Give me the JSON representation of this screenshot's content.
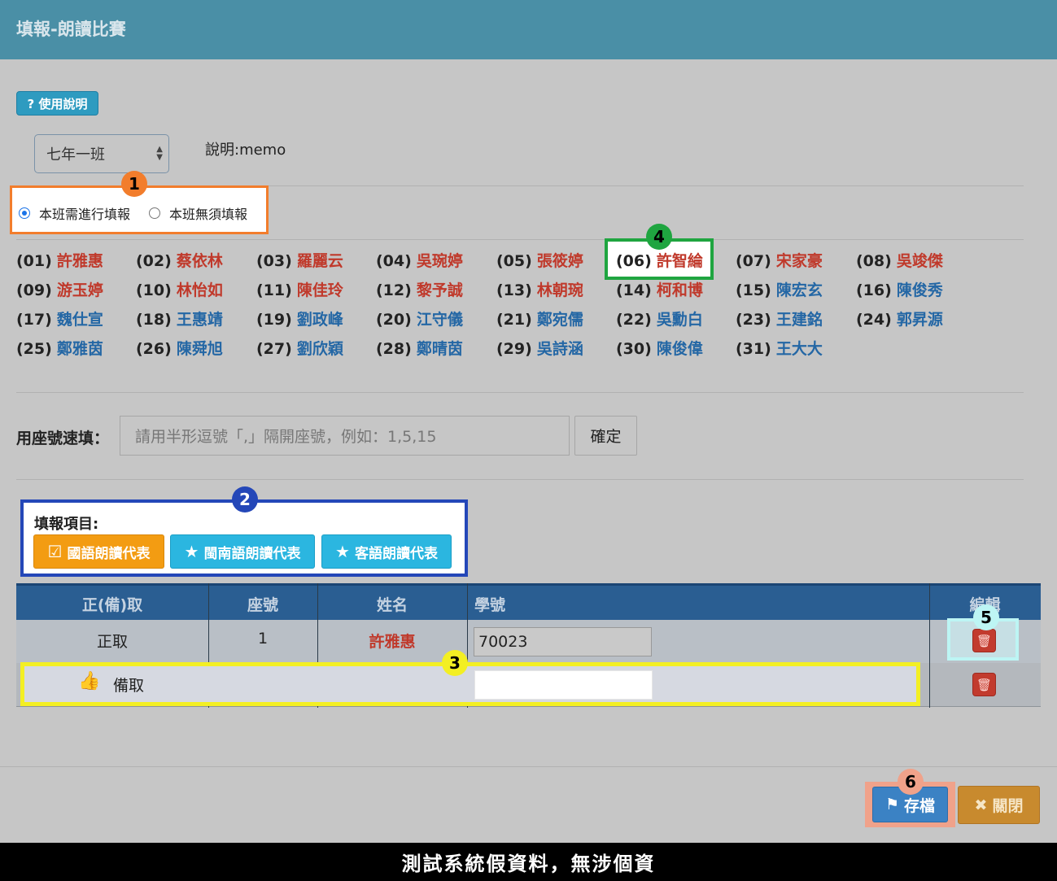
{
  "header": {
    "title": "填報-朗讀比賽"
  },
  "help_button": {
    "label": "? 使用說明"
  },
  "class_select": {
    "value": "七年一班"
  },
  "memo": {
    "text": "說明:memo"
  },
  "report_options": [
    {
      "label": "本班需進行填報",
      "checked": true
    },
    {
      "label": "本班無須填報",
      "checked": false
    }
  ],
  "badges": [
    "1",
    "2",
    "3",
    "4",
    "5",
    "6"
  ],
  "students": [
    {
      "num": "(01)",
      "name": "許雅惠",
      "color": "red"
    },
    {
      "num": "(02)",
      "name": "蔡依林",
      "color": "red"
    },
    {
      "num": "(03)",
      "name": "羅麗云",
      "color": "red"
    },
    {
      "num": "(04)",
      "name": "吳琬婷",
      "color": "red"
    },
    {
      "num": "(05)",
      "name": "張筱婷",
      "color": "red"
    },
    {
      "num": "(06)",
      "name": "許智綸",
      "color": "red"
    },
    {
      "num": "(07)",
      "name": "宋家豪",
      "color": "red"
    },
    {
      "num": "(08)",
      "name": "吳竣傑",
      "color": "red"
    },
    {
      "num": "(09)",
      "name": "游玉婷",
      "color": "red"
    },
    {
      "num": "(10)",
      "name": "林怡如",
      "color": "red"
    },
    {
      "num": "(11)",
      "name": "陳佳玲",
      "color": "red"
    },
    {
      "num": "(12)",
      "name": "黎予誠",
      "color": "red"
    },
    {
      "num": "(13)",
      "name": "林朝琬",
      "color": "red"
    },
    {
      "num": "(14)",
      "name": "柯和博",
      "color": "red"
    },
    {
      "num": "(15)",
      "name": "陳宏玄",
      "color": "blue"
    },
    {
      "num": "(16)",
      "name": "陳俊秀",
      "color": "blue"
    },
    {
      "num": "(17)",
      "name": "魏仕宣",
      "color": "blue"
    },
    {
      "num": "(18)",
      "name": "王惠靖",
      "color": "blue"
    },
    {
      "num": "(19)",
      "name": "劉政峰",
      "color": "blue"
    },
    {
      "num": "(20)",
      "name": "江守儀",
      "color": "blue"
    },
    {
      "num": "(21)",
      "name": "鄭宛儒",
      "color": "blue"
    },
    {
      "num": "(22)",
      "name": "吳勳白",
      "color": "blue"
    },
    {
      "num": "(23)",
      "name": "王建銘",
      "color": "blue"
    },
    {
      "num": "(24)",
      "name": "郭昇源",
      "color": "blue"
    },
    {
      "num": "(25)",
      "name": "鄭雅茵",
      "color": "blue"
    },
    {
      "num": "(26)",
      "name": "陳舜旭",
      "color": "blue"
    },
    {
      "num": "(27)",
      "name": "劉欣穎",
      "color": "blue"
    },
    {
      "num": "(28)",
      "name": "鄭晴茵",
      "color": "blue"
    },
    {
      "num": "(29)",
      "name": "吳詩涵",
      "color": "blue"
    },
    {
      "num": "(30)",
      "name": "陳俊偉",
      "color": "blue"
    },
    {
      "num": "(31)",
      "name": "王大大",
      "color": "blue"
    }
  ],
  "quick_fill": {
    "label": "用座號速填：",
    "placeholder": "請用半形逗號「,」隔開座號，例如：1,5,15",
    "confirm_label": "確定"
  },
  "report_items": {
    "label": "填報項目:",
    "buttons": [
      {
        "label": "國語朗讀代表",
        "icon": "checkbox-icon",
        "style": "orange"
      },
      {
        "label": "閩南語朗讀代表",
        "icon": "star-icon",
        "style": "teal"
      },
      {
        "label": "客語朗讀代表",
        "icon": "star-icon",
        "style": "teal"
      }
    ]
  },
  "table": {
    "headers": [
      "正(備)取",
      "座號",
      "姓名",
      "學號",
      "編輯"
    ],
    "rows": [
      {
        "type": "正取",
        "seat": "1",
        "name": "許雅惠",
        "student_id": "70023"
      },
      {
        "type": "備取",
        "seat": "",
        "name": "",
        "student_id": ""
      }
    ]
  },
  "footer": {
    "save_label": "存檔",
    "close_label": "關閉"
  },
  "banner": {
    "text": "測試系統假資料，無涉個資"
  },
  "colors": {
    "header_bg": "#4a8fa6",
    "red_name": "#c0392b",
    "blue_name": "#2467a5",
    "badge1": "#f27d2c",
    "badge2": "#2447b8",
    "badge3": "#f3ef23",
    "badge4": "#1fa540",
    "badge5": "#bdf5f4",
    "badge6": "#f0a28a"
  }
}
